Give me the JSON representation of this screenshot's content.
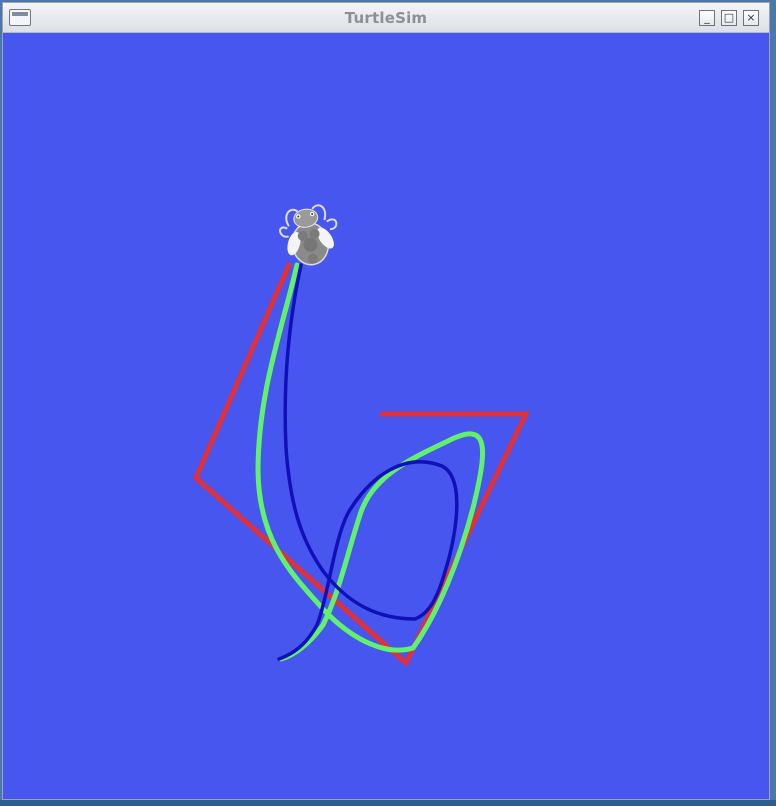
{
  "window": {
    "title": "TurtleSim",
    "buttons": {
      "minimize": "_",
      "maximize": "□",
      "close": "×"
    }
  },
  "canvas": {
    "background_color": "#4656ee"
  },
  "paths": [
    {
      "name": "red-path",
      "color": "#e0303a"
    },
    {
      "name": "green-path",
      "color": "#61f26d"
    },
    {
      "name": "blue-path",
      "color": "#1010b8"
    }
  ],
  "turtle": {
    "icon": "turtle-icon"
  }
}
